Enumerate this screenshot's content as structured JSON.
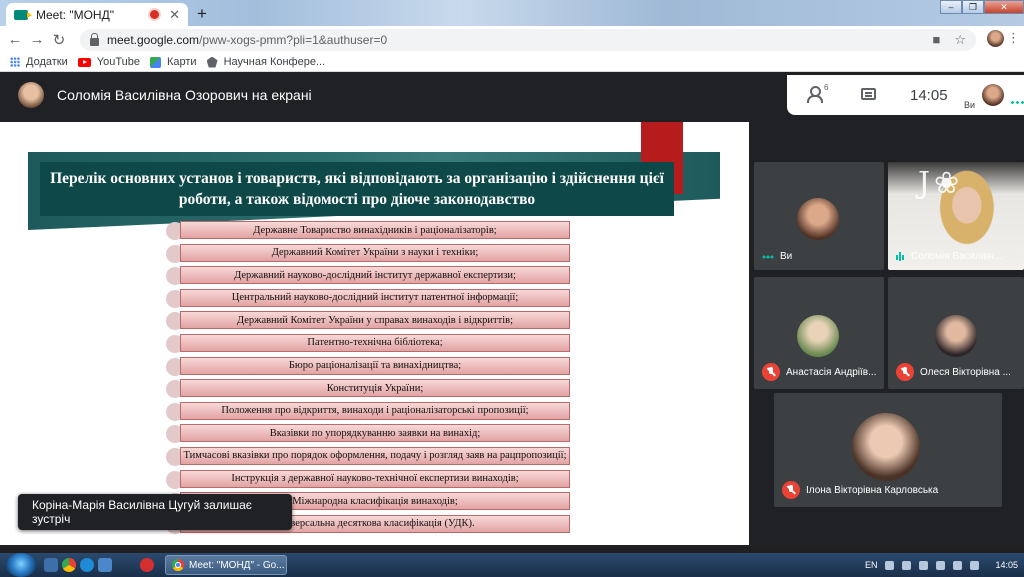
{
  "browser": {
    "tab_title": "Meet: \"МОНД\"",
    "tab_close": "✕",
    "new_tab": "+",
    "url_host": "meet.google.com",
    "url_path": "/pww-xogs-pmm?pli=1&authuser=0",
    "bookmarks": [
      {
        "label": "Додатки",
        "icon": "apps-icon"
      },
      {
        "label": "YouTube",
        "icon": "youtube-icon"
      },
      {
        "label": "Карти",
        "icon": "maps-icon"
      },
      {
        "label": "Научная Конфере...",
        "icon": "conference-icon"
      }
    ]
  },
  "meet": {
    "presenter_title": "Соломія Василівна Озорович на екрані",
    "participants_count": "6",
    "clock": "14:05",
    "self_label": "Ви",
    "toast": "Коріна-Марія Василівна Цугуй залишає зустріч"
  },
  "slide": {
    "title": "Перелік основних установ і товариств, які відповідають за організацію і здійснення цієї роботи, а також відомості про діюче законодавство",
    "items": [
      "Державне Товариство винахідників і раціоналізаторів;",
      "Державний Комітет України з науки і техніки;",
      "Державний науково-дослідний інститут державної експертизи;",
      "Центральний науково-дослідний інститут патентної інформації;",
      "Державний Комітет України у справах винаходів і відкриттів;",
      "Патентно-технічна бібліотека;",
      "Бюро раціоналізації та винахідництва;",
      "Конституція України;",
      "Положення про відкриття, винаходи і раціоналізаторські пропозиції;",
      "Вказівки по упорядкуванню заявки на винахід;",
      "Тимчасові вказівки про порядок оформлення, подачу і розгляд заяв на рацпропозиції;",
      "Інструкція з державної науково-технічної експертизи винаходів;",
      "Міжнародна класифікація винаходів;",
      "Універсальна десяткова класифікація (УДК)."
    ]
  },
  "participants": [
    {
      "name": "Ви",
      "status": "speaking"
    },
    {
      "name": "Соломія Василівн...",
      "status": "speaking"
    },
    {
      "name": "Анастасія Андріїв...",
      "status": "muted"
    },
    {
      "name": "Олеся Вікторівна ...",
      "status": "muted"
    },
    {
      "name": "Ілона Вікторівна Карловська",
      "status": "muted"
    }
  ],
  "taskbar": {
    "task_label": "Meet: \"МОНД\" - Go...",
    "lang": "EN",
    "time": "14:05"
  },
  "colors": {
    "meet_dark": "#202124",
    "tile_bg": "#3c4043",
    "slide_teal": "#0f4849",
    "slide_red": "#b71c1c",
    "mute_red": "#ea4335",
    "speaking_teal": "#00bfa5"
  }
}
